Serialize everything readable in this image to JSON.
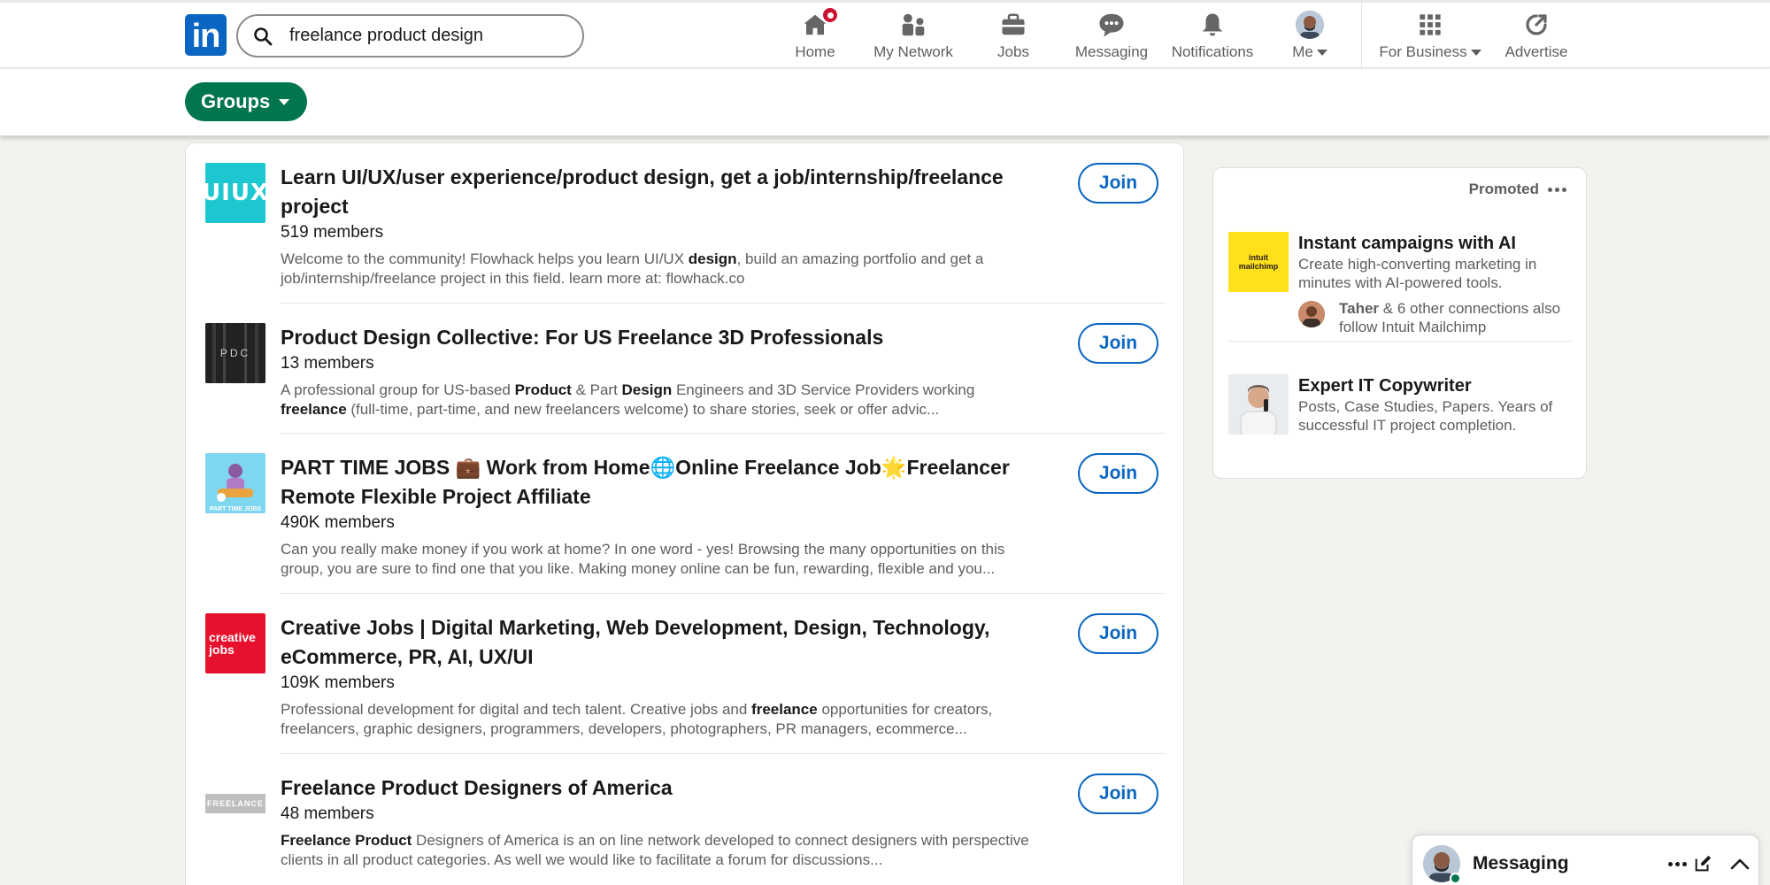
{
  "nav": {
    "search_value": "freelance product design",
    "items": [
      {
        "label": "Home",
        "icon": "home-icon"
      },
      {
        "label": "My Network",
        "icon": "network-icon"
      },
      {
        "label": "Jobs",
        "icon": "briefcase-icon"
      },
      {
        "label": "Messaging",
        "icon": "messaging-icon"
      },
      {
        "label": "Notifications",
        "icon": "bell-icon"
      },
      {
        "label": "Me",
        "icon": "avatar"
      },
      {
        "label": "For Business",
        "icon": "grid-icon"
      },
      {
        "label": "Advertise",
        "icon": "advertise-icon"
      }
    ],
    "logo_text": "in"
  },
  "filter": {
    "groups_label": "Groups"
  },
  "results": [
    {
      "title": "Learn UI/UX/user experience/product design, get a job/internship/freelance project",
      "members": "519 members",
      "desc_parts": [
        {
          "t": "Welcome to the community! Flowhack helps you learn UI/UX ",
          "b": false
        },
        {
          "t": "design",
          "b": true
        },
        {
          "t": ", build an amazing portfolio and get a job/internship/freelance project in this field. learn more at: flowhack.co",
          "b": false
        }
      ],
      "thumb_text": "UIUX",
      "join_label": "Join"
    },
    {
      "title": "Product Design Collective: For US Freelance 3D Professionals",
      "members": "13 members",
      "desc_parts": [
        {
          "t": "A professional group for US-based ",
          "b": false
        },
        {
          "t": "Product",
          "b": true
        },
        {
          "t": " & Part ",
          "b": false
        },
        {
          "t": "Design",
          "b": true
        },
        {
          "t": " Engineers and 3D Service Providers working ",
          "b": false
        },
        {
          "t": "freelance",
          "b": true
        },
        {
          "t": " (full-time, part-time, and new freelancers welcome) to share stories, seek or offer advic...",
          "b": false
        }
      ],
      "thumb_text": "PDC",
      "join_label": "Join"
    },
    {
      "title": "PART TIME JOBS 💼 Work from Home🌐Online Freelance Job🌟Freelancer Remote Flexible Project Affiliate",
      "members": "490K members",
      "desc_parts": [
        {
          "t": "Can you really make money if you work at home? In one word - yes! Browsing the many opportunities on this group, you are sure to find one that you like. Making money online can be fun, rewarding, flexible and you...",
          "b": false
        }
      ],
      "thumb_text": "PART TIME JOBS",
      "join_label": "Join"
    },
    {
      "title": "Creative Jobs | Digital Marketing, Web Development, Design, Technology, eCommerce, PR, AI, UX/UI",
      "members": "109K members",
      "desc_parts": [
        {
          "t": "Professional development for digital and tech talent. Creative jobs and ",
          "b": false
        },
        {
          "t": "freelance",
          "b": true
        },
        {
          "t": " opportunities for creators, freelancers, graphic designers, programmers, developers, photographers, PR managers, ecommerce...",
          "b": false
        }
      ],
      "thumb_text": "creative jobs",
      "join_label": "Join"
    },
    {
      "title": "Freelance Product Designers of America",
      "members": "48 members",
      "desc_parts": [
        {
          "t": "Freelance Product",
          "b": true
        },
        {
          "t": " Designers of America is an on line network developed to connect designers with perspective clients in all product categories. As well we would like to facilitate a forum for discussions...",
          "b": false
        }
      ],
      "thumb_text": "FREELANCE",
      "join_label": "Join"
    }
  ],
  "ad": {
    "promoted_label": "Promoted",
    "items": [
      {
        "title": "Instant campaigns with AI",
        "desc": "Create high-converting marketing in minutes with AI-powered tools.",
        "conn_name": "Taher",
        "conn_rest": " & 6 other connections also follow Intuit Mailchimp",
        "logo_text": "intuit mailchimp"
      },
      {
        "title": "Expert IT Copywriter",
        "desc": "Posts, Case Studies, Papers. Years of successful IT project completion."
      }
    ]
  },
  "messaging": {
    "label": "Messaging"
  },
  "colors": {
    "brand_blue": "#0a66c2",
    "groups_green": "#01754f",
    "badge_red": "#cb112d",
    "mailchimp_yellow": "#ffe01b",
    "creative_red": "#e8112d"
  }
}
